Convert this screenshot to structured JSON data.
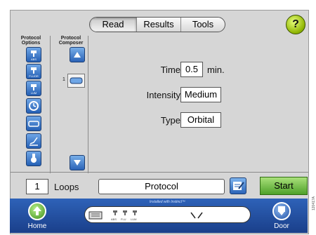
{
  "tabs": [
    "Read",
    "Results",
    "Tools"
  ],
  "active_tab": "Read",
  "help_label": "?",
  "sidebar": {
    "options_header": "Protocol Options",
    "composer_header": "Protocol Composer",
    "options": [
      {
        "icon": "absorbance-icon",
        "label": "ABS"
      },
      {
        "icon": "fluorescence-icon",
        "label": "FLUOR"
      },
      {
        "icon": "luminescence-icon",
        "label": "LUM"
      },
      {
        "icon": "clock-icon",
        "label": ""
      },
      {
        "icon": "plate-icon",
        "label": ""
      },
      {
        "icon": "kinetic-graph-icon",
        "label": ""
      },
      {
        "icon": "shake-icon",
        "label": ""
      }
    ],
    "composer_step_number": "1"
  },
  "form": {
    "time_label": "Time",
    "time_value": "0.5",
    "time_unit": "min.",
    "intensity_label": "Intensity",
    "intensity_value": "Medium",
    "type_label": "Type",
    "type_value": "Orbital"
  },
  "footer_row": {
    "loops_value": "1",
    "loops_label": "Loops",
    "protocol_name": "Protocol",
    "start_label": "Start"
  },
  "bottom_bar": {
    "home_label": "Home",
    "door_label": "Door",
    "installed_text": "Installed with Instinct™",
    "mode_labels": [
      "ABS",
      "FLU",
      "LUM"
    ]
  },
  "side_code": "120417A"
}
